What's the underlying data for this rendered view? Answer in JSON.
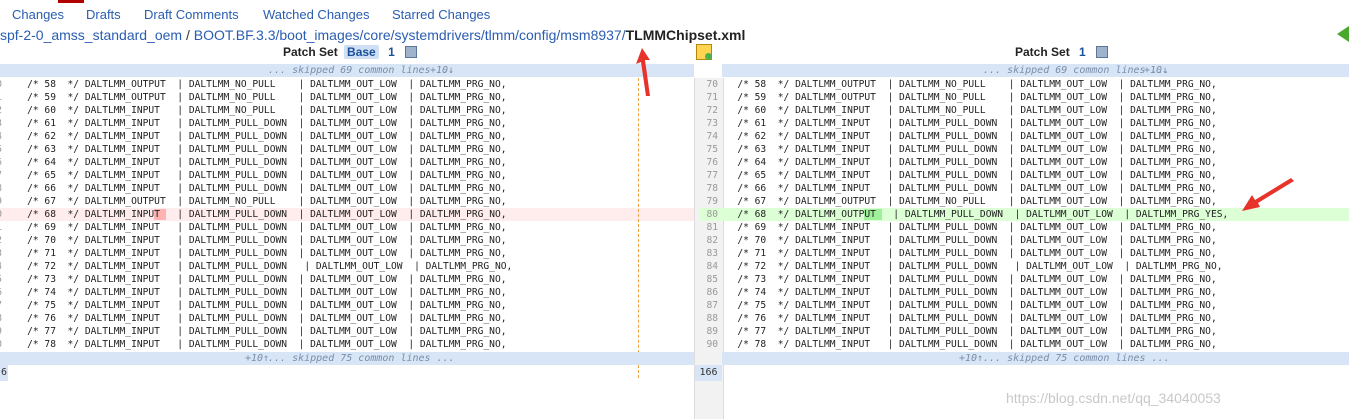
{
  "nav": {
    "items": [
      "Changes",
      "Drafts",
      "Draft Comments",
      "Watched Changes",
      "Starred Changes"
    ]
  },
  "path": {
    "prefix": "spf-2-0_amss_standard_oem",
    "sep1": " / ",
    "middle": "BOOT.BF.3.3/boot_images/core/systemdrivers/tlmm/config/msm8937/",
    "file": "TLMMChipset.xml"
  },
  "left_header": {
    "label": "Patch Set",
    "base": "Base",
    "num": "1"
  },
  "right_header": {
    "label": "Patch Set",
    "num": "1"
  },
  "skip_top": {
    "left": "... skipped 69 common lines ...",
    "left_plus": "+10↓",
    "right": "... skipped 69 common lines ...",
    "right_plus": "+10↓"
  },
  "skip_bottom": {
    "left_plus": "+10↑",
    "left": "... skipped 75 common lines ...",
    "right_plus": "+10↑",
    "right": "... skipped 75 common lines ..."
  },
  "left_lines": [
    {
      "n": "0",
      "code": "    /* 58  */ DALTLMM_OUTPUT  | DALTLMM_NO_PULL    | DALTLMM_OUT_LOW  | DALTLMM_PRG_NO,"
    },
    {
      "n": "1",
      "code": "    /* 59  */ DALTLMM_OUTPUT  | DALTLMM_NO_PULL    | DALTLMM_OUT_LOW  | DALTLMM_PRG_NO,"
    },
    {
      "n": "2",
      "code": "    /* 60  */ DALTLMM_INPUT   | DALTLMM_NO_PULL    | DALTLMM_OUT_LOW  | DALTLMM_PRG_NO,"
    },
    {
      "n": "3",
      "code": "    /* 61  */ DALTLMM_INPUT   | DALTLMM_PULL_DOWN  | DALTLMM_OUT_LOW  | DALTLMM_PRG_NO,"
    },
    {
      "n": "4",
      "code": "    /* 62  */ DALTLMM_INPUT   | DALTLMM_PULL_DOWN  | DALTLMM_OUT_LOW  | DALTLMM_PRG_NO,"
    },
    {
      "n": "5",
      "code": "    /* 63  */ DALTLMM_INPUT   | DALTLMM_PULL_DOWN  | DALTLMM_OUT_LOW  | DALTLMM_PRG_NO,"
    },
    {
      "n": "6",
      "code": "    /* 64  */ DALTLMM_INPUT   | DALTLMM_PULL_DOWN  | DALTLMM_OUT_LOW  | DALTLMM_PRG_NO,"
    },
    {
      "n": "7",
      "code": "    /* 65  */ DALTLMM_INPUT   | DALTLMM_PULL_DOWN  | DALTLMM_OUT_LOW  | DALTLMM_PRG_NO,"
    },
    {
      "n": "8",
      "code": "    /* 66  */ DALTLMM_INPUT   | DALTLMM_PULL_DOWN  | DALTLMM_OUT_LOW  | DALTLMM_PRG_NO,"
    },
    {
      "n": "9",
      "code": "    /* 67  */ DALTLMM_OUTPUT  | DALTLMM_NO_PULL    | DALTLMM_OUT_LOW  | DALTLMM_PRG_NO,"
    },
    {
      "n": "0",
      "code": "    /* 68  */ DALTLMM_INPUT   | DALTLMM_PULL_DOWN  | DALTLMM_OUT_LOW  | DALTLMM_PRG_NO,",
      "type": "del",
      "hl": [
        [
          "IN",
          26,
          28
        ],
        [
          "NO",
          96,
          98
        ]
      ]
    },
    {
      "n": "1",
      "code": "    /* 69  */ DALTLMM_INPUT   | DALTLMM_PULL_DOWN  | DALTLMM_OUT_LOW  | DALTLMM_PRG_NO,"
    },
    {
      "n": "2",
      "code": "    /* 70  */ DALTLMM_INPUT   | DALTLMM_PULL_DOWN  | DALTLMM_OUT_LOW  | DALTLMM_PRG_NO,"
    },
    {
      "n": "3",
      "code": "    /* 71  */ DALTLMM_INPUT   | DALTLMM_PULL_DOWN  | DALTLMM_OUT_LOW  | DALTLMM_PRG_NO,"
    },
    {
      "n": "4",
      "code": "    /* 72  */ DALTLMM_INPUT   | DALTLMM_PULL_DOWN   | DALTLMM_OUT_LOW  | DALTLMM_PRG_NO,"
    },
    {
      "n": "5",
      "code": "    /* 73  */ DALTLMM_INPUT   | DALTLMM_PULL_DOWN  | DALTLMM_OUT_LOW  | DALTLMM_PRG_NO,"
    },
    {
      "n": "6",
      "code": "    /* 74  */ DALTLMM_INPUT   | DALTLMM_PULL_DOWN  | DALTLMM_OUT_LOW  | DALTLMM_PRG_NO,"
    },
    {
      "n": "7",
      "code": "    /* 75  */ DALTLMM_INPUT   | DALTLMM_PULL_DOWN  | DALTLMM_OUT_LOW  | DALTLMM_PRG_NO,"
    },
    {
      "n": "8",
      "code": "    /* 76  */ DALTLMM_INPUT   | DALTLMM_PULL_DOWN  | DALTLMM_OUT_LOW  | DALTLMM_PRG_NO,"
    },
    {
      "n": "9",
      "code": "    /* 77  */ DALTLMM_INPUT   | DALTLMM_PULL_DOWN  | DALTLMM_OUT_LOW  | DALTLMM_PRG_NO,"
    },
    {
      "n": "0",
      "code": "    /* 78  */ DALTLMM_INPUT   | DALTLMM_PULL_DOWN  | DALTLMM_OUT_LOW  | DALTLMM_PRG_NO,"
    }
  ],
  "right_lines": [
    {
      "n": "70",
      "code": "   /* 58  */ DALTLMM_OUTPUT  | DALTLMM_NO_PULL    | DALTLMM_OUT_LOW  | DALTLMM_PRG_NO,"
    },
    {
      "n": "71",
      "code": "   /* 59  */ DALTLMM_OUTPUT  | DALTLMM_NO_PULL    | DALTLMM_OUT_LOW  | DALTLMM_PRG_NO,"
    },
    {
      "n": "72",
      "code": "   /* 60  */ DALTLMM_INPUT   | DALTLMM_NO_PULL    | DALTLMM_OUT_LOW  | DALTLMM_PRG_NO,"
    },
    {
      "n": "73",
      "code": "   /* 61  */ DALTLMM_INPUT   | DALTLMM_PULL_DOWN  | DALTLMM_OUT_LOW  | DALTLMM_PRG_NO,"
    },
    {
      "n": "74",
      "code": "   /* 62  */ DALTLMM_INPUT   | DALTLMM_PULL_DOWN  | DALTLMM_OUT_LOW  | DALTLMM_PRG_NO,"
    },
    {
      "n": "75",
      "code": "   /* 63  */ DALTLMM_INPUT   | DALTLMM_PULL_DOWN  | DALTLMM_OUT_LOW  | DALTLMM_PRG_NO,"
    },
    {
      "n": "76",
      "code": "   /* 64  */ DALTLMM_INPUT   | DALTLMM_PULL_DOWN  | DALTLMM_OUT_LOW  | DALTLMM_PRG_NO,"
    },
    {
      "n": "77",
      "code": "   /* 65  */ DALTLMM_INPUT   | DALTLMM_PULL_DOWN  | DALTLMM_OUT_LOW  | DALTLMM_PRG_NO,"
    },
    {
      "n": "78",
      "code": "   /* 66  */ DALTLMM_INPUT   | DALTLMM_PULL_DOWN  | DALTLMM_OUT_LOW  | DALTLMM_PRG_NO,"
    },
    {
      "n": "79",
      "code": "   /* 67  */ DALTLMM_OUTPUT  | DALTLMM_NO_PULL    | DALTLMM_OUT_LOW  | DALTLMM_PRG_NO,"
    },
    {
      "n": "80",
      "code": "   /* 68  */ DALTLMM_OUTPUT   | DALTLMM_PULL_DOWN  | DALTLMM_OUT_LOW  | DALTLMM_PRG_YES,",
      "type": "add",
      "hl": [
        [
          "OUT",
          25,
          28
        ],
        [
          "YES",
          97,
          100
        ]
      ]
    },
    {
      "n": "81",
      "code": "   /* 69  */ DALTLMM_INPUT   | DALTLMM_PULL_DOWN  | DALTLMM_OUT_LOW  | DALTLMM_PRG_NO,"
    },
    {
      "n": "82",
      "code": "   /* 70  */ DALTLMM_INPUT   | DALTLMM_PULL_DOWN  | DALTLMM_OUT_LOW  | DALTLMM_PRG_NO,"
    },
    {
      "n": "83",
      "code": "   /* 71  */ DALTLMM_INPUT   | DALTLMM_PULL_DOWN  | DALTLMM_OUT_LOW  | DALTLMM_PRG_NO,"
    },
    {
      "n": "84",
      "code": "   /* 72  */ DALTLMM_INPUT   | DALTLMM_PULL_DOWN   | DALTLMM_OUT_LOW  | DALTLMM_PRG_NO,"
    },
    {
      "n": "85",
      "code": "   /* 73  */ DALTLMM_INPUT   | DALTLMM_PULL_DOWN  | DALTLMM_OUT_LOW  | DALTLMM_PRG_NO,"
    },
    {
      "n": "86",
      "code": "   /* 74  */ DALTLMM_INPUT   | DALTLMM_PULL_DOWN  | DALTLMM_OUT_LOW  | DALTLMM_PRG_NO,"
    },
    {
      "n": "87",
      "code": "   /* 75  */ DALTLMM_INPUT   | DALTLMM_PULL_DOWN  | DALTLMM_OUT_LOW  | DALTLMM_PRG_NO,"
    },
    {
      "n": "88",
      "code": "   /* 76  */ DALTLMM_INPUT   | DALTLMM_PULL_DOWN  | DALTLMM_OUT_LOW  | DALTLMM_PRG_NO,"
    },
    {
      "n": "89",
      "code": "   /* 77  */ DALTLMM_INPUT   | DALTLMM_PULL_DOWN  | DALTLMM_OUT_LOW  | DALTLMM_PRG_NO,"
    },
    {
      "n": "90",
      "code": "   /* 78  */ DALTLMM_INPUT   | DALTLMM_PULL_DOWN  | DALTLMM_OUT_LOW  | DALTLMM_PRG_NO,"
    }
  ],
  "left_last_line_num": "6",
  "right_last_line_num": "166",
  "watermark": "https://blog.csdn.net/qq_34040053",
  "colors": {
    "link": "#2a5db0",
    "del_bg": "#ffecec",
    "add_bg": "#dcffd6",
    "skip_bg": "#d7e5f7",
    "annotation": "#e8332a"
  }
}
